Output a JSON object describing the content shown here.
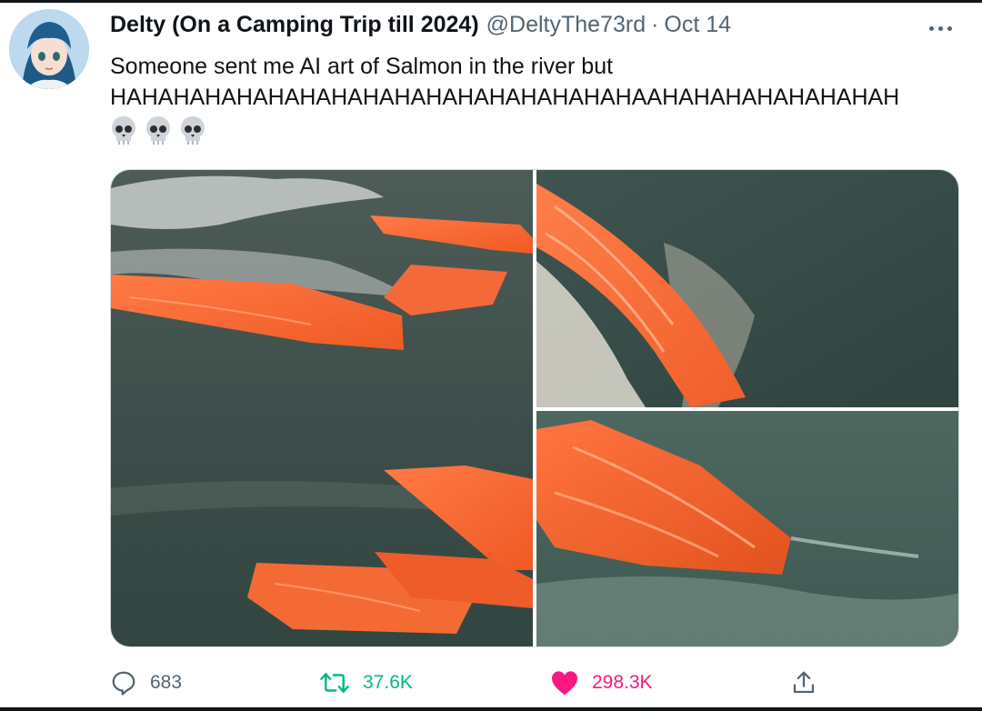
{
  "tweet": {
    "display_name": "Delty (On a Camping Trip till 2024)",
    "handle": "@DeltyThe73rd",
    "separator": "·",
    "date": "Oct 14",
    "text_lines": [
      "Someone sent me AI art of Salmon in the river but",
      "HAHAHAHAHAHAHAHAHAHAHAHAHAHAHAHAHAAHAHAHAHAHAHAHAH"
    ],
    "emojis": [
      "skull-emoji",
      "skull-emoji",
      "skull-emoji"
    ],
    "media": [
      {
        "name": "ai-salmon-fillets-river-image-1"
      },
      {
        "name": "ai-salmon-fillet-splash-image-2"
      },
      {
        "name": "ai-salmon-fillet-water-image-3"
      }
    ]
  },
  "actions": {
    "reply_count": "683",
    "retweet_count": "37.6K",
    "like_count": "298.3K"
  },
  "icons": [
    "more-icon",
    "reply-icon",
    "retweet-icon",
    "heart-icon",
    "share-icon"
  ],
  "colors": {
    "text": "#0f1419",
    "secondary": "#536471",
    "retweet": "#00ba7c",
    "like": "#f91880"
  }
}
